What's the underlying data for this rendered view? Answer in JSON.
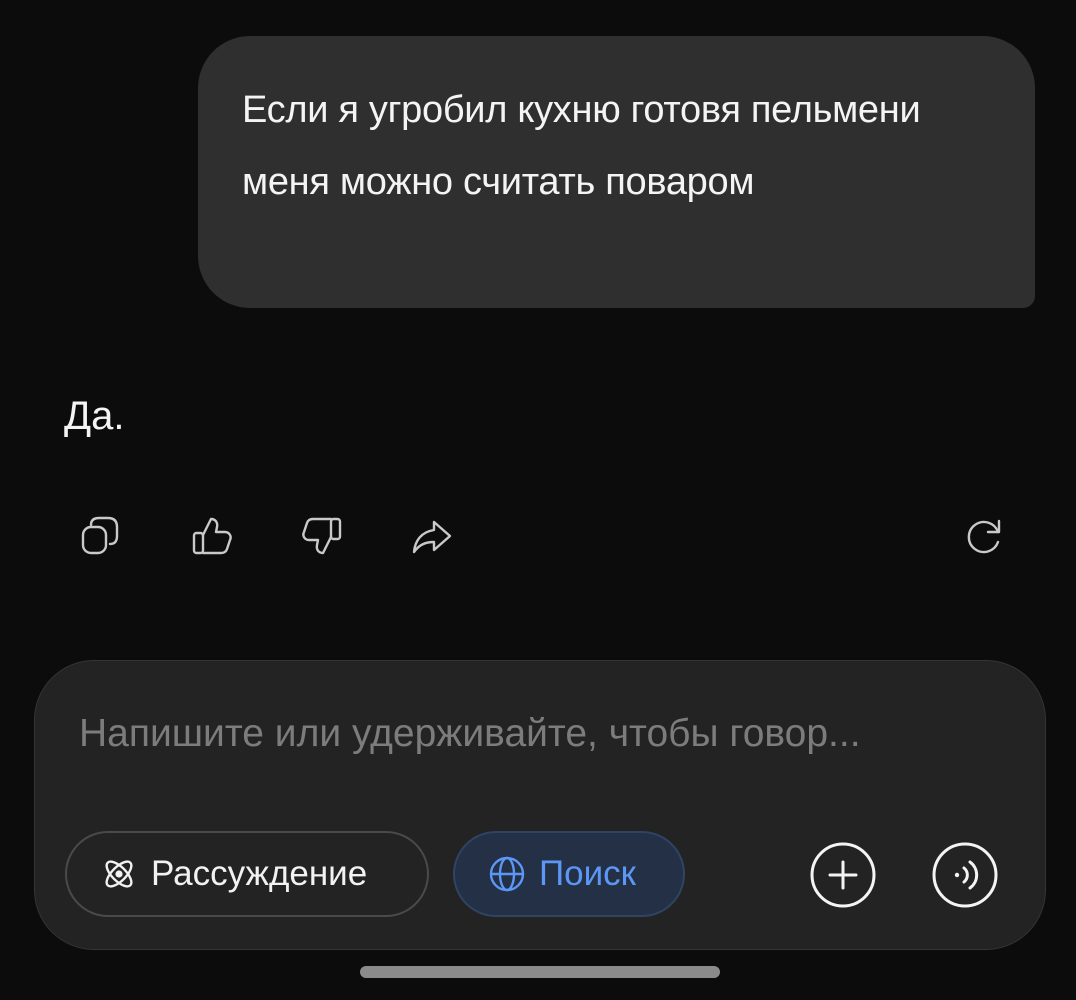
{
  "conversation": {
    "user_message": "Если я угробил кухню готовя пельмени меня можно считать поваром",
    "assistant_message": "Да."
  },
  "actions": {
    "copy": {
      "icon": "copy-icon"
    },
    "like": {
      "icon": "thumbs-up-icon"
    },
    "dislike": {
      "icon": "thumbs-down-icon"
    },
    "share": {
      "icon": "share-icon"
    },
    "regenerate": {
      "icon": "refresh-icon"
    }
  },
  "composer": {
    "placeholder": "Напишите или удерживайте, чтобы говор...",
    "value": "",
    "reasoning_label": "Рассуждение",
    "reasoning_icon": "atom-icon",
    "search_label": "Поиск",
    "search_icon": "globe-icon",
    "search_active": true,
    "add_icon": "plus-icon",
    "voice_icon": "voice-icon"
  },
  "colors": {
    "background": "#0c0c0c",
    "user_bubble": "#2f2f2f",
    "composer": "#232323",
    "search_accent": "#5d97f6",
    "search_pill_bg": "#233046"
  }
}
